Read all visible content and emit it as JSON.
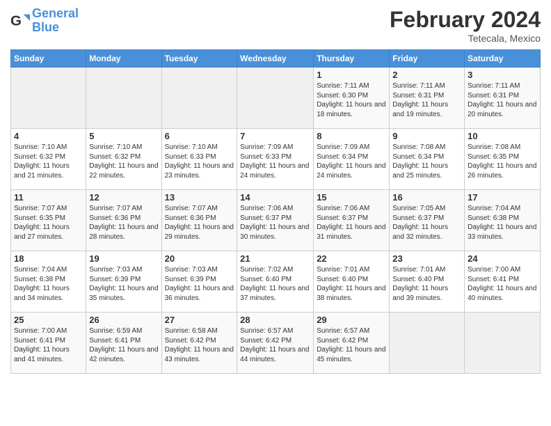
{
  "header": {
    "logo_line1": "General",
    "logo_line2": "Blue",
    "month_title": "February 2024",
    "location": "Tetecala, Mexico"
  },
  "days_of_week": [
    "Sunday",
    "Monday",
    "Tuesday",
    "Wednesday",
    "Thursday",
    "Friday",
    "Saturday"
  ],
  "weeks": [
    [
      {
        "day": "",
        "info": ""
      },
      {
        "day": "",
        "info": ""
      },
      {
        "day": "",
        "info": ""
      },
      {
        "day": "",
        "info": ""
      },
      {
        "day": "1",
        "info": "Sunrise: 7:11 AM\nSunset: 6:30 PM\nDaylight: 11 hours and 18 minutes."
      },
      {
        "day": "2",
        "info": "Sunrise: 7:11 AM\nSunset: 6:31 PM\nDaylight: 11 hours and 19 minutes."
      },
      {
        "day": "3",
        "info": "Sunrise: 7:11 AM\nSunset: 6:31 PM\nDaylight: 11 hours and 20 minutes."
      }
    ],
    [
      {
        "day": "4",
        "info": "Sunrise: 7:10 AM\nSunset: 6:32 PM\nDaylight: 11 hours and 21 minutes."
      },
      {
        "day": "5",
        "info": "Sunrise: 7:10 AM\nSunset: 6:32 PM\nDaylight: 11 hours and 22 minutes."
      },
      {
        "day": "6",
        "info": "Sunrise: 7:10 AM\nSunset: 6:33 PM\nDaylight: 11 hours and 23 minutes."
      },
      {
        "day": "7",
        "info": "Sunrise: 7:09 AM\nSunset: 6:33 PM\nDaylight: 11 hours and 24 minutes."
      },
      {
        "day": "8",
        "info": "Sunrise: 7:09 AM\nSunset: 6:34 PM\nDaylight: 11 hours and 24 minutes."
      },
      {
        "day": "9",
        "info": "Sunrise: 7:08 AM\nSunset: 6:34 PM\nDaylight: 11 hours and 25 minutes."
      },
      {
        "day": "10",
        "info": "Sunrise: 7:08 AM\nSunset: 6:35 PM\nDaylight: 11 hours and 26 minutes."
      }
    ],
    [
      {
        "day": "11",
        "info": "Sunrise: 7:07 AM\nSunset: 6:35 PM\nDaylight: 11 hours and 27 minutes."
      },
      {
        "day": "12",
        "info": "Sunrise: 7:07 AM\nSunset: 6:36 PM\nDaylight: 11 hours and 28 minutes."
      },
      {
        "day": "13",
        "info": "Sunrise: 7:07 AM\nSunset: 6:36 PM\nDaylight: 11 hours and 29 minutes."
      },
      {
        "day": "14",
        "info": "Sunrise: 7:06 AM\nSunset: 6:37 PM\nDaylight: 11 hours and 30 minutes."
      },
      {
        "day": "15",
        "info": "Sunrise: 7:06 AM\nSunset: 6:37 PM\nDaylight: 11 hours and 31 minutes."
      },
      {
        "day": "16",
        "info": "Sunrise: 7:05 AM\nSunset: 6:37 PM\nDaylight: 11 hours and 32 minutes."
      },
      {
        "day": "17",
        "info": "Sunrise: 7:04 AM\nSunset: 6:38 PM\nDaylight: 11 hours and 33 minutes."
      }
    ],
    [
      {
        "day": "18",
        "info": "Sunrise: 7:04 AM\nSunset: 6:38 PM\nDaylight: 11 hours and 34 minutes."
      },
      {
        "day": "19",
        "info": "Sunrise: 7:03 AM\nSunset: 6:39 PM\nDaylight: 11 hours and 35 minutes."
      },
      {
        "day": "20",
        "info": "Sunrise: 7:03 AM\nSunset: 6:39 PM\nDaylight: 11 hours and 36 minutes."
      },
      {
        "day": "21",
        "info": "Sunrise: 7:02 AM\nSunset: 6:40 PM\nDaylight: 11 hours and 37 minutes."
      },
      {
        "day": "22",
        "info": "Sunrise: 7:01 AM\nSunset: 6:40 PM\nDaylight: 11 hours and 38 minutes."
      },
      {
        "day": "23",
        "info": "Sunrise: 7:01 AM\nSunset: 6:40 PM\nDaylight: 11 hours and 39 minutes."
      },
      {
        "day": "24",
        "info": "Sunrise: 7:00 AM\nSunset: 6:41 PM\nDaylight: 11 hours and 40 minutes."
      }
    ],
    [
      {
        "day": "25",
        "info": "Sunrise: 7:00 AM\nSunset: 6:41 PM\nDaylight: 11 hours and 41 minutes."
      },
      {
        "day": "26",
        "info": "Sunrise: 6:59 AM\nSunset: 6:41 PM\nDaylight: 11 hours and 42 minutes."
      },
      {
        "day": "27",
        "info": "Sunrise: 6:58 AM\nSunset: 6:42 PM\nDaylight: 11 hours and 43 minutes."
      },
      {
        "day": "28",
        "info": "Sunrise: 6:57 AM\nSunset: 6:42 PM\nDaylight: 11 hours and 44 minutes."
      },
      {
        "day": "29",
        "info": "Sunrise: 6:57 AM\nSunset: 6:42 PM\nDaylight: 11 hours and 45 minutes."
      },
      {
        "day": "",
        "info": ""
      },
      {
        "day": "",
        "info": ""
      }
    ]
  ]
}
